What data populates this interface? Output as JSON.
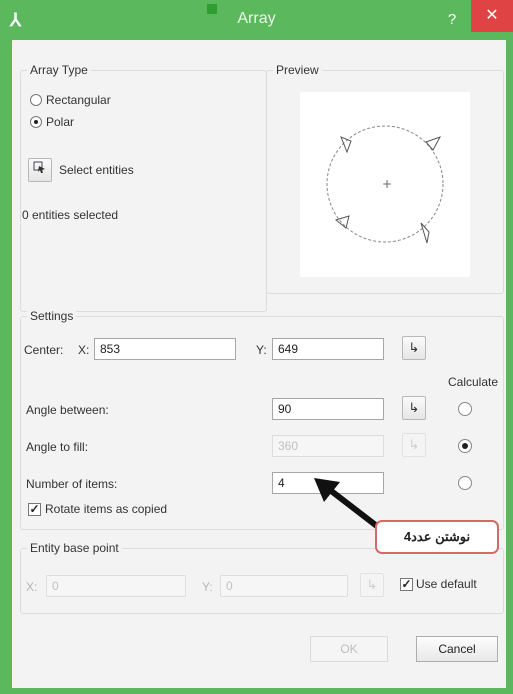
{
  "window": {
    "title": "Array",
    "help_glyph": "?",
    "close_glyph": "✕",
    "app_glyph": "⅄"
  },
  "array_type": {
    "legend": "Array Type",
    "options": [
      {
        "label": "Rectangular",
        "checked": false
      },
      {
        "label": "Polar",
        "checked": true
      }
    ],
    "select_button": "Select entities",
    "selected_status": "0 entities selected"
  },
  "preview": {
    "legend": "Preview"
  },
  "settings": {
    "legend": "Settings",
    "center_label": "Center:",
    "x_label": "X:",
    "x_value": "853",
    "y_label": "Y:",
    "y_value": "649",
    "calculate_label": "Calculate",
    "rows": [
      {
        "label": "Angle between:",
        "value": "90",
        "enabled": true,
        "calc_checked": false
      },
      {
        "label": "Angle to fill:",
        "value": "360",
        "enabled": false,
        "calc_checked": true
      },
      {
        "label": "Number of items:",
        "value": "4",
        "enabled": true,
        "calc_checked": false
      }
    ],
    "rotate_label": "Rotate items as copied",
    "rotate_checked": true
  },
  "base_point": {
    "legend": "Entity base point",
    "x_label": "X:",
    "x_value": "0",
    "y_label": "Y:",
    "y_value": "0",
    "use_default_label": "Use default",
    "use_default_checked": true
  },
  "buttons": {
    "ok": "OK",
    "cancel": "Cancel"
  },
  "annotation": {
    "callout_text": "نوشتن عدد4"
  },
  "colors": {
    "titlebar": "#5cb85c",
    "close": "#e04343",
    "callout_border": "#d46a6a"
  }
}
